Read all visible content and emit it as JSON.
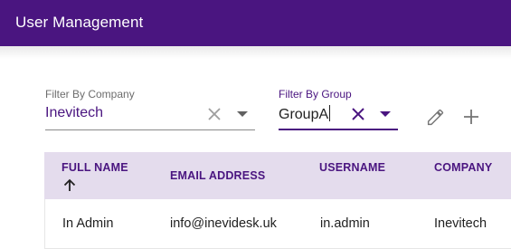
{
  "app": {
    "title": "User Management"
  },
  "filters": {
    "company": {
      "label": "Filter By Company",
      "value": "Inevitech"
    },
    "group": {
      "label": "Filter By Group",
      "value": "GroupA"
    }
  },
  "actions": {
    "icons": [
      "pencil-icon",
      "plus-icon"
    ]
  },
  "table": {
    "columns": [
      {
        "label": "FULL NAME",
        "sort": "ascending"
      },
      {
        "label": "EMAIL ADDRESS"
      },
      {
        "label": "USERNAME"
      },
      {
        "label": "COMPANY"
      }
    ],
    "rows": [
      {
        "full_name": "In Admin",
        "email": "info@inevidesk.uk",
        "username": "in.admin",
        "company": "Inevitech"
      }
    ]
  },
  "colors": {
    "brand": "#4a1580",
    "header_bg": "#e4dced",
    "icon_grey": "#9e9e9e",
    "icon_dark": "#616161"
  }
}
